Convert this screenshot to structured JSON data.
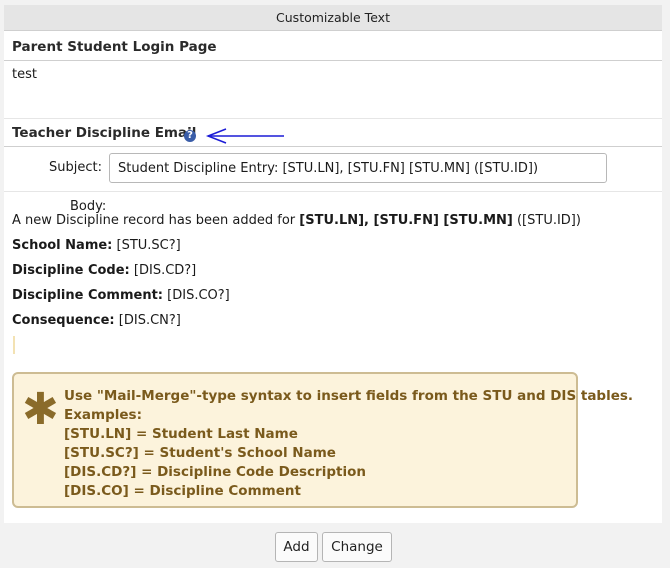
{
  "header": {
    "title": "Customizable Text"
  },
  "parent_login": {
    "title": "Parent Student Login Page",
    "value": "test"
  },
  "teacher_email": {
    "title": "Teacher Discipline Email",
    "help_icon": "question-circle-icon",
    "subject_label": "Subject:",
    "subject_value": "Student Discipline Entry: [STU.LN], [STU.FN] [STU.MN] ([STU.ID])",
    "body_label": "Body:",
    "body": {
      "line1_prefix": "A new Discipline record has been added for ",
      "line1_bold": "[STU.LN], [STU.FN] [STU.MN]",
      "line1_suffix": " ([STU.ID])",
      "fields": [
        {
          "label": "School Name:",
          "value": " [STU.SC?]"
        },
        {
          "label": "Discipline Code:",
          "value": " [DIS.CD?]"
        },
        {
          "label": "Discipline Comment:",
          "value": " [DIS.CO?]"
        },
        {
          "label": "Consequence:",
          "value": " [DIS.CN?]"
        }
      ]
    }
  },
  "note": {
    "icon": "asterisk-icon",
    "lines": [
      "Use \"Mail-Merge\"-type syntax to insert fields from the STU and DIS tables.",
      "Examples:",
      "[STU.LN] = Student Last Name",
      "[STU.SC?] = Student's School Name",
      "[DIS.CD?] = Discipline Code Description",
      "[DIS.CO] = Discipline Comment"
    ]
  },
  "buttons": {
    "add": "Add",
    "change": "Change"
  },
  "colors": {
    "arrow": "#1c1cd6",
    "note_text": "#7a5a1c",
    "help_icon": "#3a5da8"
  }
}
